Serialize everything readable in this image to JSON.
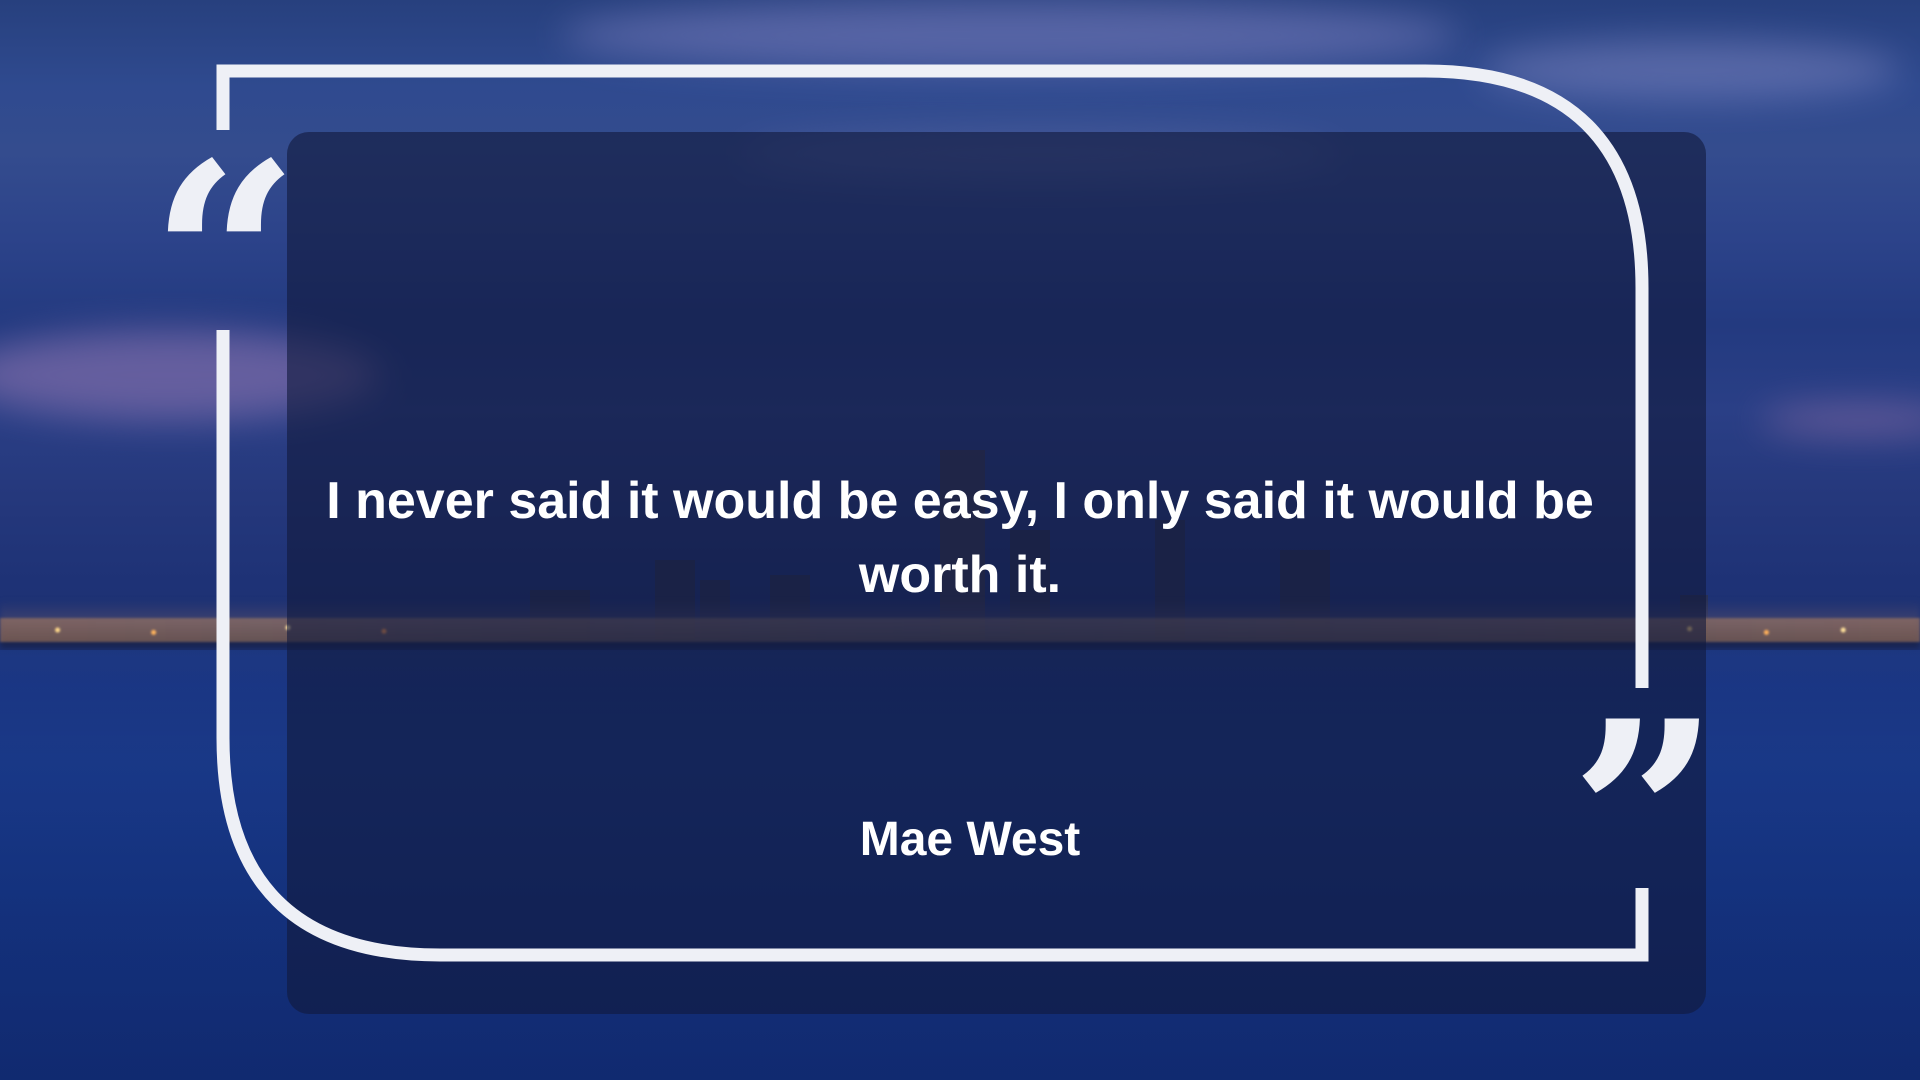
{
  "quote": {
    "text": "I never said it would be easy, I only said it would be worth it.",
    "author": "Mae West",
    "open_mark": "“",
    "close_mark": "”"
  },
  "background": {
    "scene": "night-city-skyline-over-water",
    "sky_color": "#2c438a",
    "water_color": "#173684",
    "frame_color": "#eef0f6",
    "panel_color": "#121a3e"
  }
}
